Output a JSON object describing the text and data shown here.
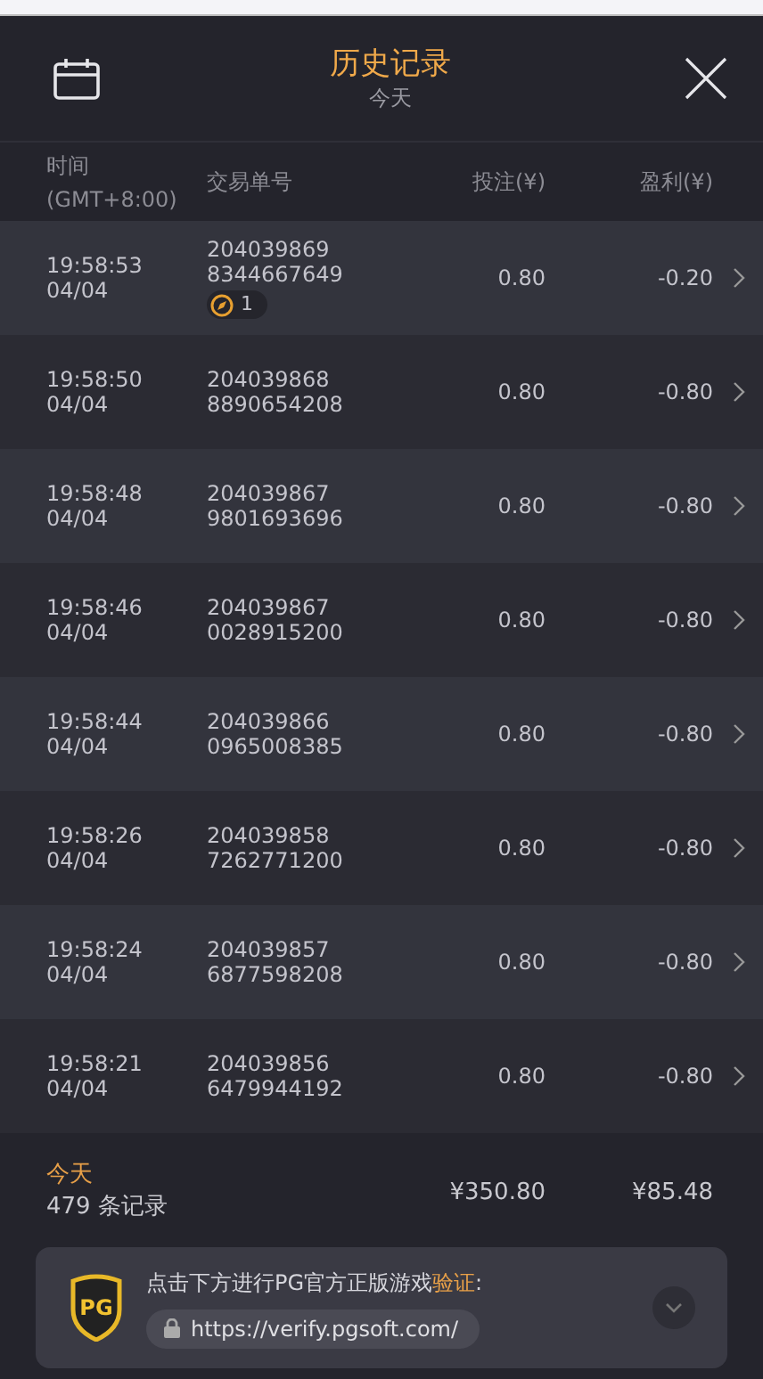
{
  "header": {
    "title": "历史记录",
    "subtitle": "今天"
  },
  "columns": [
    {
      "label": "时间",
      "sublabel": "(GMT+8:00)"
    },
    {
      "label": "交易单号"
    },
    {
      "label": "投注(¥)"
    },
    {
      "label": "盈利(¥)"
    }
  ],
  "rows": [
    {
      "time": "19:58:53",
      "date": "04/04",
      "id_line_1": "204039869",
      "id_line_2": "8344667649",
      "badge": "1",
      "bet": "0.80",
      "profit": "-0.20"
    },
    {
      "time": "19:58:50",
      "date": "04/04",
      "id_line_1": "204039868",
      "id_line_2": "8890654208",
      "bet": "0.80",
      "profit": "-0.80"
    },
    {
      "time": "19:58:48",
      "date": "04/04",
      "id_line_1": "204039867",
      "id_line_2": "9801693696",
      "bet": "0.80",
      "profit": "-0.80"
    },
    {
      "time": "19:58:46",
      "date": "04/04",
      "id_line_1": "204039867",
      "id_line_2": "0028915200",
      "bet": "0.80",
      "profit": "-0.80"
    },
    {
      "time": "19:58:44",
      "date": "04/04",
      "id_line_1": "204039866",
      "id_line_2": "0965008385",
      "bet": "0.80",
      "profit": "-0.80"
    },
    {
      "time": "19:58:26",
      "date": "04/04",
      "id_line_1": "204039858",
      "id_line_2": "7262771200",
      "bet": "0.80",
      "profit": "-0.80"
    },
    {
      "time": "19:58:24",
      "date": "04/04",
      "id_line_1": "204039857",
      "id_line_2": "6877598208",
      "bet": "0.80",
      "profit": "-0.80"
    },
    {
      "time": "19:58:21",
      "date": "04/04",
      "id_line_1": "204039856",
      "id_line_2": "6479944192",
      "bet": "0.80",
      "profit": "-0.80"
    }
  ],
  "summary": {
    "period": "今天",
    "count": "479 条记录",
    "total_bet": "¥350.80",
    "total_profit": "¥85.48"
  },
  "verify": {
    "logo": "PG",
    "message": "点击下方进行PG官方正版游戏",
    "highlight": "验证",
    "colon": ":",
    "url": "https://verify.pgsoft.com/"
  }
}
